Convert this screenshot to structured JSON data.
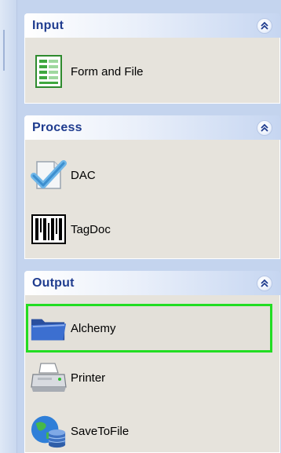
{
  "panels": [
    {
      "title": "Input",
      "items": [
        {
          "label": "Form and File",
          "icon": "form-document-icon"
        }
      ]
    },
    {
      "title": "Process",
      "items": [
        {
          "label": "DAC",
          "icon": "checkmark-document-icon"
        },
        {
          "label": "TagDoc",
          "icon": "barcode-icon"
        }
      ]
    },
    {
      "title": "Output",
      "items": [
        {
          "label": "Alchemy",
          "icon": "folder-icon",
          "selected": true
        },
        {
          "label": "Printer",
          "icon": "printer-icon"
        },
        {
          "label": "SaveToFile",
          "icon": "globe-database-icon"
        }
      ]
    }
  ],
  "colors": {
    "background": "#c4d4ee",
    "panel_body": "#e6e3dc",
    "header_text": "#1f3c8f",
    "selection_border": "#22dd22"
  }
}
